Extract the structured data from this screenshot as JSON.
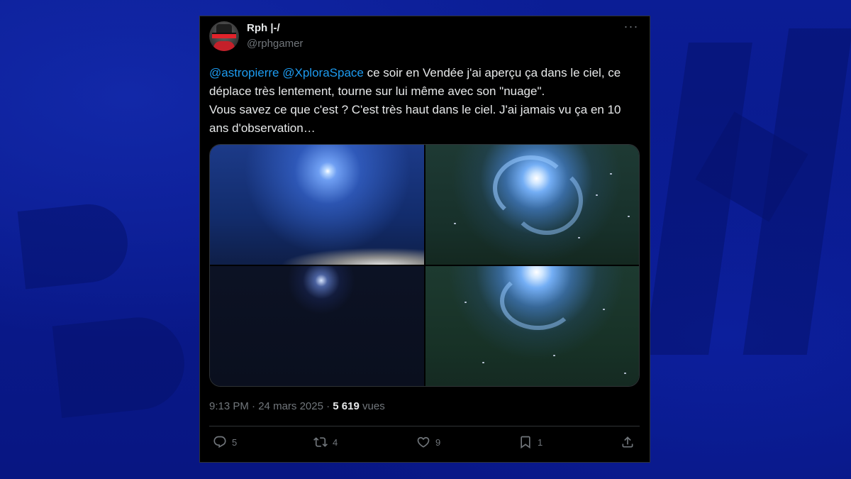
{
  "tweet": {
    "author_name": "Rph |-/",
    "author_handle": "@rphgamer",
    "more_label": "···",
    "mention_1": "@astropierre",
    "mention_2": "@XploraSpace",
    "text_1": " ce soir en Vendée j'ai aperçu ça dans le ciel, ce déplace très lentement, tourne sur lui même avec son \"nuage\".",
    "text_2": "Vous savez ce que c'est ? C'est très haut dans le ciel. J'ai jamais vu ça en 10 ans d'observation…",
    "time": "9:13 PM",
    "separator": " · ",
    "date": "24 mars 2025",
    "view_count": "5 619",
    "view_label": "vues",
    "replies": "5",
    "retweets": "4",
    "likes": "9",
    "bookmarks": "1"
  },
  "media": {
    "photo_count": 4
  },
  "colors": {
    "background": "#0a1a8c",
    "card": "#000000",
    "text": "#e7e9ea",
    "secondary": "#71767b",
    "link": "#1d9bf0",
    "border": "#2f3336"
  },
  "icons": [
    "reply-icon",
    "retweet-icon",
    "like-icon",
    "bookmark-icon",
    "share-icon",
    "more-icon"
  ]
}
